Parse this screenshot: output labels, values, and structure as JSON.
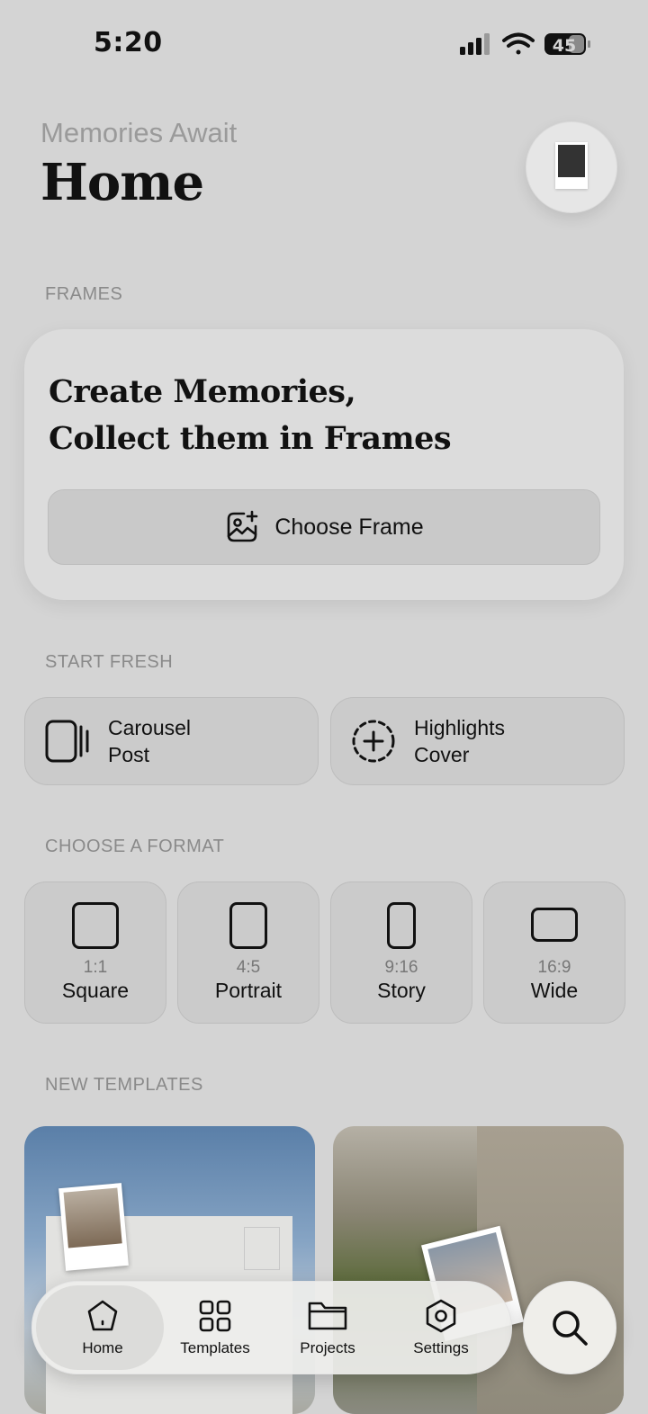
{
  "status_bar": {
    "time": "5:20",
    "battery": "45"
  },
  "header": {
    "subtitle": "Memories Await",
    "title": "Home"
  },
  "frames": {
    "section_label": "FRAMES",
    "heading_line1": "Create Memories,",
    "heading_line2": "Collect them in Frames",
    "button_label": "Choose Frame"
  },
  "start_fresh": {
    "section_label": "START FRESH",
    "items": [
      {
        "line1": "Carousel",
        "line2": "Post",
        "icon": "carousel-icon"
      },
      {
        "line1": "Highlights",
        "line2": "Cover",
        "icon": "add-circle-dashed-icon"
      }
    ]
  },
  "formats": {
    "section_label": "CHOOSE A FORMAT",
    "items": [
      {
        "ratio": "1:1",
        "name": "Square"
      },
      {
        "ratio": "4:5",
        "name": "Portrait"
      },
      {
        "ratio": "9:16",
        "name": "Story"
      },
      {
        "ratio": "16:9",
        "name": "Wide"
      }
    ]
  },
  "templates": {
    "section_label": "NEW TEMPLATES"
  },
  "nav": {
    "items": [
      {
        "label": "Home",
        "icon": "home-icon",
        "active": true
      },
      {
        "label": "Templates",
        "icon": "templates-grid-icon"
      },
      {
        "label": "Projects",
        "icon": "folder-icon"
      },
      {
        "label": "Settings",
        "icon": "settings-hexagon-icon"
      }
    ]
  }
}
